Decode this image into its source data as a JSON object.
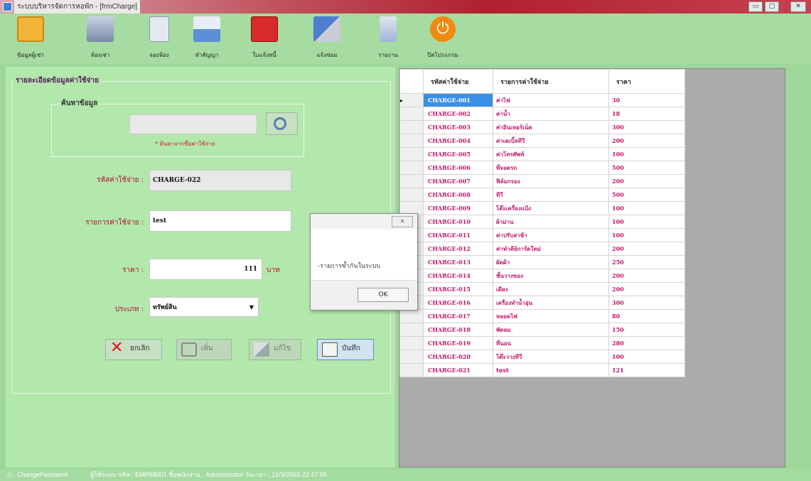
{
  "window": {
    "title": "ระบบบริหารจัดการหอพัก - [frmCharge]",
    "min": "▭",
    "max": "▢",
    "close": "✕"
  },
  "toolbar": {
    "items": [
      {
        "label": "ข้อมูลผู้เช่า",
        "icon": "folder-icon",
        "color": "#f0b437"
      },
      {
        "label": "ห้องเช่า",
        "icon": "building-icon",
        "color": "#9aa9c0"
      },
      {
        "label": "จองห้อง",
        "icon": "document-icon",
        "color": "#c9d3e3"
      },
      {
        "label": "ทำสัญญา",
        "icon": "contract-icon",
        "color": "#5b8fd6"
      },
      {
        "label": "ใบแจ้งหนี้",
        "icon": "invoice-folder-icon",
        "color": "#d82a2a"
      },
      {
        "label": "แจ้งซ่อม",
        "icon": "repair-icon",
        "color": "#4f7ed0"
      },
      {
        "label": "รายงาน",
        "icon": "report-icon",
        "color": "#9fb6d9"
      },
      {
        "label": "ปิดโปรแกรม",
        "icon": "power-icon",
        "color": "#f08a10"
      }
    ]
  },
  "form": {
    "group_title": "รายละเอียดข้อมูลค่าใช้จ่าย",
    "search": {
      "group_title": "ค้นหาข้อมูล",
      "value": "",
      "hint": "* ค้นหาจากชื่อค่าใช้จ่าย"
    },
    "code_label": "รหัสค่าใช้จ่าย :",
    "code_value": "CHARGE-022",
    "name_label": "รายการค่าใช้จ่าย :",
    "name_value": "test",
    "price_label": "ราคา :",
    "price_value": "111",
    "price_unit": "บาท",
    "type_label": "ประเภท :",
    "type_value": "ทรัพย์สิน",
    "buttons": {
      "cancel": "ยกเลิก",
      "add": "เพิ่ม",
      "edit": "แก้ไข",
      "save": "บันทึก"
    }
  },
  "grid": {
    "headers": [
      "รหัสค่าใช้จ่าย",
      "รายการค่าใช้จ่าย",
      "ราคา"
    ],
    "rows": [
      [
        "CHARGE-001",
        "ค่าไฟ",
        "30"
      ],
      [
        "CHARGE-002",
        "ค่าน้ำ",
        "18"
      ],
      [
        "CHARGE-003",
        "ค่าอินเทอร์เน็ต",
        "300"
      ],
      [
        "CHARGE-004",
        "ค่าเคเบิ้ลทีวี",
        "200"
      ],
      [
        "CHARGE-005",
        "ค่าโทรศัพท์",
        "100"
      ],
      [
        "CHARGE-006",
        "ที่จอดรถ",
        "500"
      ],
      [
        "CHARGE-007",
        "ฟิล์มกรอง",
        "200"
      ],
      [
        "CHARGE-008",
        "ทีวี",
        "500"
      ],
      [
        "CHARGE-009",
        "โต๊ะเครื่องแป้ง",
        "100"
      ],
      [
        "CHARGE-010",
        "ผ้าม่าน",
        "100"
      ],
      [
        "CHARGE-011",
        "ค่าปรับล่าช้า",
        "100"
      ],
      [
        "CHARGE-012",
        "ค่าทำคีย์การ์ดใหม่",
        "200"
      ],
      [
        "CHARGE-013",
        "ผัดผ้า",
        "250"
      ],
      [
        "CHARGE-014",
        "ชั้นวางของ",
        "200"
      ],
      [
        "CHARGE-015",
        "เตียง",
        "200"
      ],
      [
        "CHARGE-016",
        "เครื่องทำน้ำอุ่น",
        "300"
      ],
      [
        "CHARGE-017",
        "หลอดไฟ",
        "80"
      ],
      [
        "CHARGE-018",
        "พัดลม",
        "150"
      ],
      [
        "CHARGE-019",
        "ที่นอน",
        "280"
      ],
      [
        "CHARGE-020",
        "โต๊ะวางทีวี",
        "100"
      ],
      [
        "CHARGE-021",
        "test",
        "121"
      ]
    ],
    "row_marker": "▸"
  },
  "dialog": {
    "message": "-รายการซ้ำกันในระบบ",
    "ok": "OK",
    "close": "✕"
  },
  "status": {
    "change_password": "ChangePassword",
    "user_info": "ผู้ใช้ระบบ รหัส : EMP58001  ชื่อพนักงาน : Administrator  วันเวลา : 12/3/2563 22:47:55"
  }
}
